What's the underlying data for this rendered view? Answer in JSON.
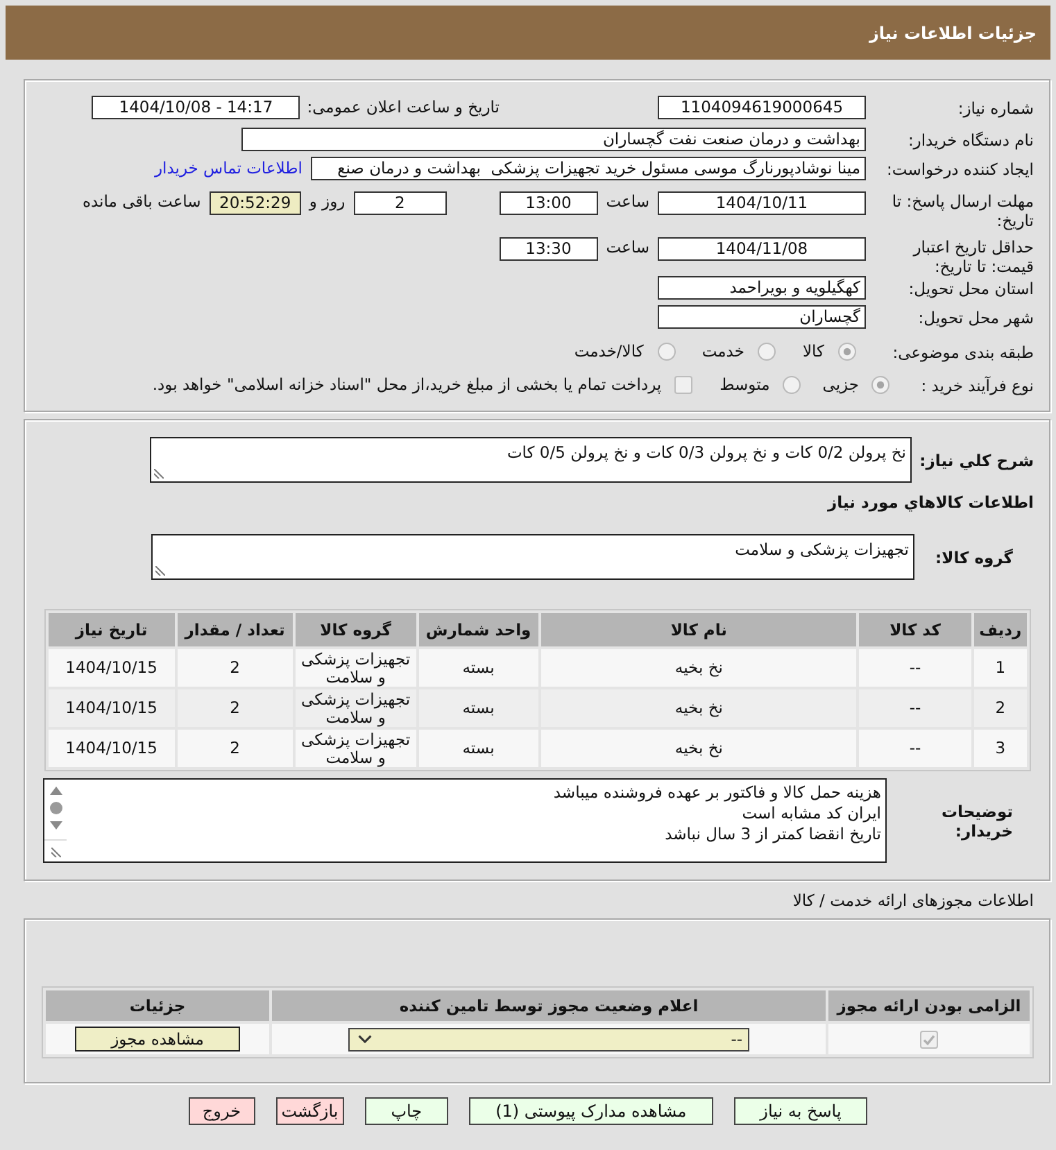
{
  "header": {
    "title": "جزئیات اطلاعات نیاز"
  },
  "need_details": {
    "need_number": {
      "label": "شماره نیاز:",
      "value": "1104094619000645"
    },
    "announcement": {
      "label": "تاریخ و ساعت اعلان عمومی:",
      "value": "1404/10/08 - 14:17"
    },
    "buyer_org": {
      "label": "نام دستگاه خریدار:",
      "value": "بهداشت و درمان صنعت نفت گچساران"
    },
    "requester": {
      "label": "ایجاد کننده درخواست:",
      "value": "مینا نوشادپورنارگ موسی مسئول خرید تجهیزات پزشکی  بهداشت و درمان صنع",
      "link": "اطلاعات تماس خریدار"
    },
    "reply_deadline": {
      "label": "مهلت ارسال پاسخ: تا تاریخ:",
      "date": "1404/10/11",
      "time_label": "ساعت",
      "time": "13:00",
      "days": "2",
      "days_label": "روز و",
      "remaining": "20:52:29",
      "remaining_label": "ساعت باقی مانده"
    },
    "price_validity": {
      "label": "حداقل تاریخ اعتبار قیمت: تا تاریخ:",
      "date": "1404/11/08",
      "time_label": "ساعت",
      "time": "13:30"
    },
    "delivery_province": {
      "label": "استان محل تحویل:",
      "value": "کهگیلویه و بویراحمد"
    },
    "delivery_city": {
      "label": "شهر محل تحویل:",
      "value": "گچساران"
    },
    "subject_category": {
      "label": "طبقه بندی موضوعی:",
      "disabled": true,
      "options": [
        {
          "label": "کالا",
          "selected": true
        },
        {
          "label": "خدمت",
          "selected": false
        },
        {
          "label": "کالا/خدمت",
          "selected": false
        }
      ]
    },
    "purchase_process": {
      "label": "نوع فرآیند خرید :",
      "disabled": true,
      "options": [
        {
          "label": "جزیی",
          "selected": true
        },
        {
          "label": "متوسط",
          "selected": false
        }
      ],
      "treasury_payment": {
        "label": "پرداخت تمام یا بخشی از مبلغ خرید،از محل \"اسناد خزانه اسلامی\" خواهد بود.",
        "checked": false,
        "disabled": true
      }
    }
  },
  "goods": {
    "description": {
      "label": "شرح کلي نياز:",
      "value": "نخ پرولن 0/2 کات و نخ پرولن 0/3 کات و نخ پرولن 0/5 کات"
    },
    "section_title": "اطلاعات كالاهاي مورد نياز",
    "group": {
      "label": "گروه کالا:",
      "value": "تجهیزات پزشکی و سلامت"
    },
    "table": {
      "columns": [
        "ردیف",
        "کد کالا",
        "نام کالا",
        "واحد شمارش",
        "گروه کالا",
        "تعداد / مقدار",
        "تاریخ نیاز"
      ],
      "rows": [
        [
          "1",
          "--",
          "نخ بخیه",
          "بسته",
          "تجهیزات پزشکی و سلامت",
          "2",
          "1404/10/15"
        ],
        [
          "2",
          "--",
          "نخ بخیه",
          "بسته",
          "تجهیزات پزشکی و سلامت",
          "2",
          "1404/10/15"
        ],
        [
          "3",
          "--",
          "نخ بخیه",
          "بسته",
          "تجهیزات پزشکی و سلامت",
          "2",
          "1404/10/15"
        ]
      ]
    },
    "buyer_notes": {
      "label": "توضیحات خریدار:",
      "lines": [
        "هزینه حمل کالا و فاکتور بر عهده فروشنده میباشد",
        "ایران کد مشابه است",
        "تاریخ انقضا کمتر از 3 سال نباشد"
      ]
    }
  },
  "permits": {
    "title": "اطلاعات مجوزهای ارائه خدمت / کالا",
    "columns": [
      "الزامی بودن ارائه مجوز",
      "اعلام وضعیت مجوز توسط تامین کننده",
      "جزئیات"
    ],
    "rows": [
      {
        "required": true,
        "disabled": true,
        "status": "--",
        "details_button": "مشاهده مجوز"
      }
    ]
  },
  "actions": [
    {
      "label": "پاسخ به نیاز",
      "kind": "action"
    },
    {
      "label": "مشاهده مدارک پیوستی (1)",
      "kind": "action"
    },
    {
      "label": "چاپ",
      "kind": "action"
    },
    {
      "label": "بازگشت",
      "kind": "cancel"
    },
    {
      "label": "خروج",
      "kind": "cancel"
    }
  ]
}
